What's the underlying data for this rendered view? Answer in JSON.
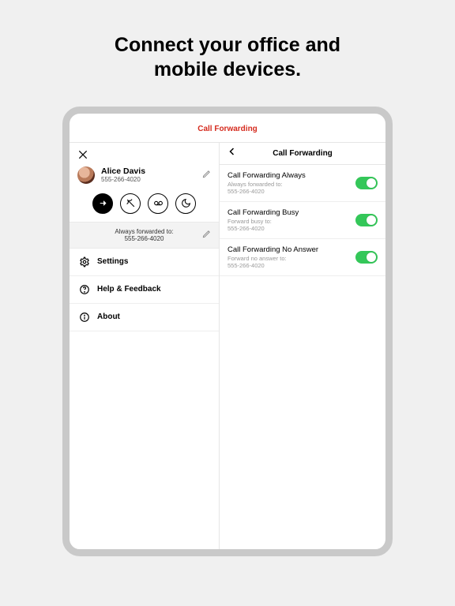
{
  "hero": {
    "line1": "Connect your office and",
    "line2": "mobile devices."
  },
  "header": {
    "title": "Call Forwarding"
  },
  "profile": {
    "name": "Alice Davis",
    "number": "555-266-4020"
  },
  "forward_info": {
    "label": "Always forwarded to:",
    "number": "555-266-4020"
  },
  "menu": {
    "settings": "Settings",
    "help": "Help & Feedback",
    "about": "About"
  },
  "detail": {
    "title": "Call Forwarding",
    "items": [
      {
        "title": "Call Forwarding Always",
        "sub1": "Always forwarded to:",
        "sub2": "555-266-4020",
        "on": true
      },
      {
        "title": "Call Forwarding Busy",
        "sub1": "Forward busy to:",
        "sub2": "555-266-4020",
        "on": true
      },
      {
        "title": "Call Forwarding No Answer",
        "sub1": "Forward no answer to:",
        "sub2": "555-266-4020",
        "on": true
      }
    ]
  }
}
